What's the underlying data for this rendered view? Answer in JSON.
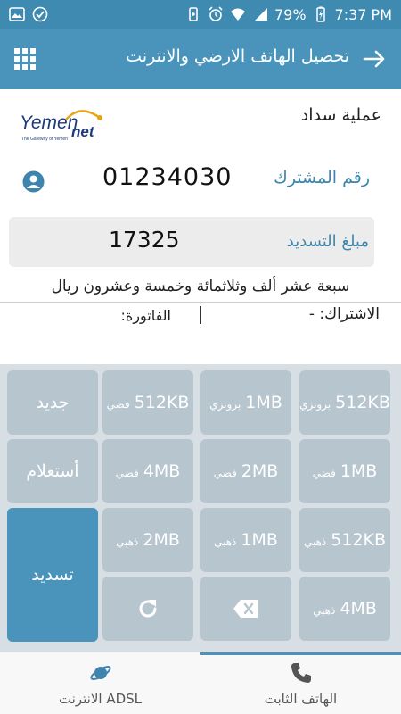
{
  "status_bar": {
    "battery_percent": "79%",
    "time": "7:37 PM"
  },
  "app_bar": {
    "title": "تحصيل الهاتف الارضي والانترنت",
    "menu_icon": "grid-menu-icon",
    "back_icon": "arrow-right-icon"
  },
  "operation": {
    "title": "عملية سداد",
    "logo_text": "YemenNet",
    "logo_tagline": "The Gateway of Yemen"
  },
  "subscriber": {
    "label": "رقم المشترك",
    "number": "01234030"
  },
  "payment": {
    "label": "مبلغ التسديد",
    "amount": "17325",
    "amount_words": "سبعة عشر ألف وثلاثمائة وخمسة وعشرون ريال"
  },
  "details": {
    "subscription": "الاشتراك: -",
    "bill": "الفاتورة:"
  },
  "keypad": {
    "row1": [
      {
        "size": "512KB",
        "tier": "برونزي"
      },
      {
        "size": "1MB",
        "tier": "برونزي"
      },
      {
        "size": "512KB",
        "tier": "فضي"
      }
    ],
    "row2": [
      {
        "size": "1MB",
        "tier": "فضي"
      },
      {
        "size": "2MB",
        "tier": "فضي"
      },
      {
        "size": "4MB",
        "tier": "فضي"
      }
    ],
    "row3": [
      {
        "size": "512KB",
        "tier": "ذهبي"
      },
      {
        "size": "1MB",
        "tier": "ذهبي"
      },
      {
        "size": "2MB",
        "tier": "ذهبي"
      }
    ],
    "row4": [
      {
        "size": "4MB",
        "tier": "ذهبي"
      }
    ],
    "new_label": "جديد",
    "query_label": "أستعلام",
    "pay_label": "تسديد"
  },
  "bottom_nav": {
    "tabs": [
      {
        "label": "الهاتف الثابت",
        "icon": "phone-icon",
        "active": true
      },
      {
        "label": "الانترنت ADSL",
        "icon": "planet-icon",
        "active": false
      }
    ]
  },
  "colors": {
    "primary": "#4a94bb",
    "status_bar": "#3e8ab0",
    "key_bg": "#b7c5cf",
    "keypad_bg": "#d7dee4",
    "label_blue": "#3c86ad"
  }
}
